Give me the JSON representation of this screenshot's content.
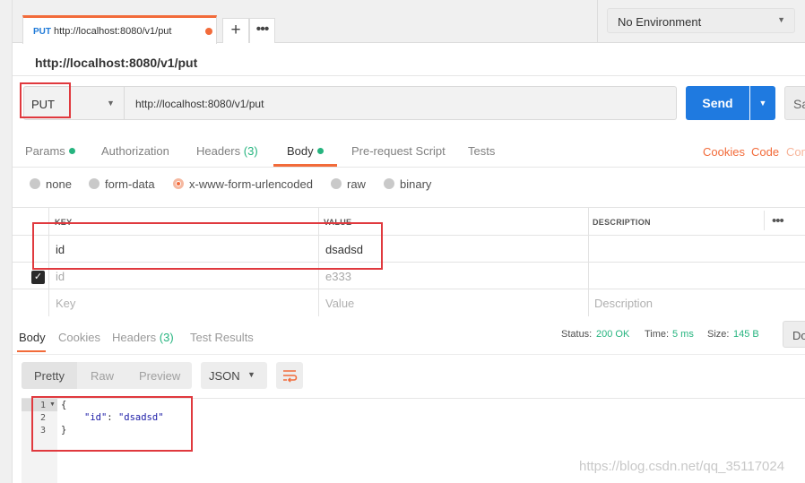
{
  "tab": {
    "method": "PUT",
    "url": "http://localhost:8080/v1/put"
  },
  "tabstrip": {
    "plus": "+",
    "more": "•••"
  },
  "environment": {
    "label": "No Environment",
    "chevron": "▼"
  },
  "title": "http://localhost:8080/v1/put",
  "request": {
    "method": "PUT",
    "method_chevron": "▼",
    "url": "http://localhost:8080/v1/put",
    "send": "Send",
    "send_chevron": "▼",
    "save": "Sa"
  },
  "subtabs": {
    "params": "Params",
    "authorization": "Authorization",
    "headers": "Headers",
    "headers_count": "(3)",
    "body": "Body",
    "prerequest": "Pre-request Script",
    "tests": "Tests"
  },
  "links": {
    "cookies": "Cookies",
    "code": "Code",
    "comments": "Com"
  },
  "body_types": [
    "none",
    "form-data",
    "x-www-form-urlencoded",
    "raw",
    "binary"
  ],
  "kv": {
    "headers": {
      "key": "KEY",
      "value": "VALUE",
      "description": "DESCRIPTION",
      "more": "•••"
    },
    "rows": [
      {
        "key": "id",
        "value": "dsadsd",
        "checked": true
      },
      {
        "key": "id",
        "value": "e333",
        "checked": false
      }
    ],
    "placeholder": {
      "key": "Key",
      "value": "Value",
      "description": "Description"
    }
  },
  "response": {
    "tabs": {
      "body": "Body",
      "cookies": "Cookies",
      "headers": "Headers",
      "headers_count": "(3)",
      "test_results": "Test Results"
    },
    "status_label": "Status:",
    "status_value": "200 OK",
    "time_label": "Time:",
    "time_value": "5 ms",
    "size_label": "Size:",
    "size_value": "145 B",
    "download": "Do",
    "views": {
      "pretty": "Pretty",
      "raw": "Raw",
      "preview": "Preview"
    },
    "format": "JSON",
    "format_chevron": "▼",
    "lines": [
      "1",
      "2",
      "3"
    ],
    "code": {
      "open": "{",
      "key": "\"id\"",
      "colon": ": ",
      "value": "\"dsadsd\"",
      "close": "}"
    }
  },
  "watermark": "https://blog.csdn.net/qq_35117024"
}
